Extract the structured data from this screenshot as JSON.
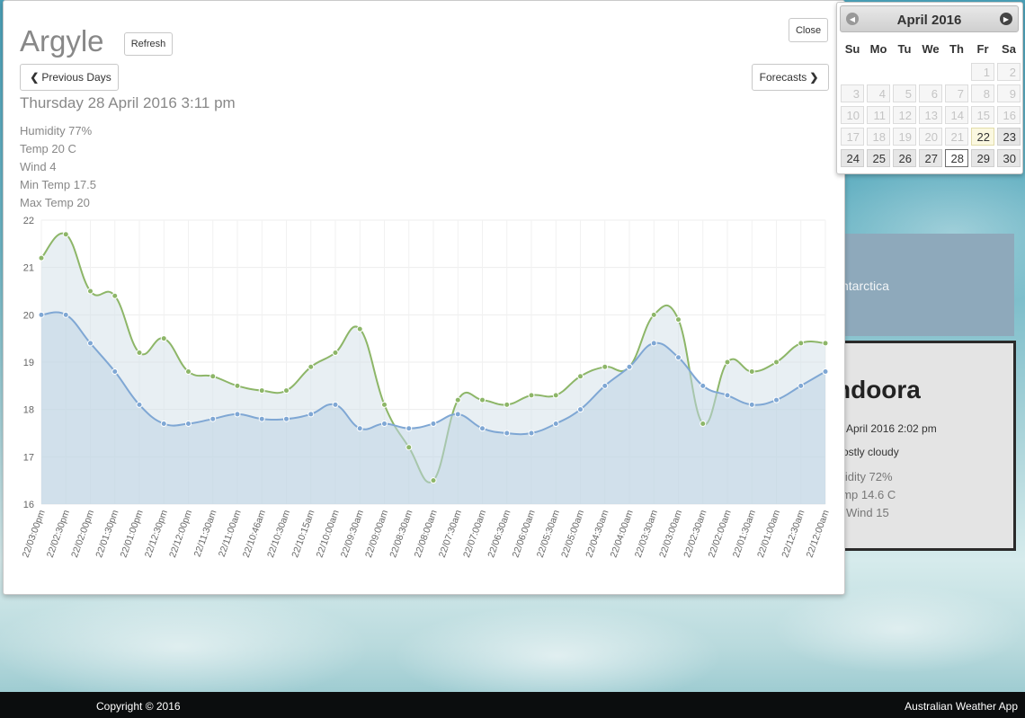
{
  "modal": {
    "title": "Argyle",
    "refresh_label": "Refresh",
    "close_label": "Close",
    "prev_label": "Previous Days",
    "forecasts_label": "Forecasts",
    "datetime": "Thursday 28 April 2016 3:11 pm",
    "stats": [
      "Humidity 77%",
      "Temp 20 C",
      "Wind 4",
      "Min Temp 17.5",
      "Max Temp 20"
    ]
  },
  "chart_data": {
    "type": "line",
    "ylim": [
      16,
      22
    ],
    "yticks": [
      "16",
      "17",
      "18",
      "19",
      "20",
      "21",
      "22"
    ],
    "categories": [
      "22/03:00pm",
      "22/02:30pm",
      "22/02:00pm",
      "22/01:30pm",
      "22/01:00pm",
      "22/12:30pm",
      "22/12:00pm",
      "22/11:30am",
      "22/11:00am",
      "22/10:46am",
      "22/10:30am",
      "22/10:15am",
      "22/10:00am",
      "22/09:30am",
      "22/09:00am",
      "22/08:30am",
      "22/08:00am",
      "22/07:30am",
      "22/07:00am",
      "22/06:30am",
      "22/06:00am",
      "22/05:30am",
      "22/05:00am",
      "22/04:30am",
      "22/04:00am",
      "22/03:30am",
      "22/03:00am",
      "22/02:30am",
      "22/02:00am",
      "22/01:30am",
      "22/01:00am",
      "22/12:30am",
      "22/12:00am"
    ],
    "series": [
      {
        "values": [
          21.2,
          21.7,
          20.5,
          20.4,
          19.2,
          19.5,
          18.8,
          18.7,
          18.5,
          18.4,
          18.4,
          18.9,
          19.2,
          19.7,
          18.1,
          17.2,
          16.5,
          18.2,
          18.2,
          18.1,
          18.3,
          18.3,
          18.7,
          18.9,
          18.9,
          20.0,
          19.9,
          17.7,
          19.0,
          18.8,
          19.0,
          19.4,
          19.4
        ],
        "color": "#8db668"
      },
      {
        "values": [
          20.0,
          20.0,
          19.4,
          18.8,
          18.1,
          17.7,
          17.7,
          17.8,
          17.9,
          17.8,
          17.8,
          17.9,
          18.1,
          17.6,
          17.7,
          17.6,
          17.7,
          17.9,
          17.6,
          17.5,
          17.5,
          17.7,
          18.0,
          18.5,
          18.9,
          19.4,
          19.1,
          18.5,
          18.3,
          18.1,
          18.2,
          18.5,
          18.8
        ],
        "color": "#7fa7d4"
      }
    ]
  },
  "calendar": {
    "title": "April 2016",
    "days_of_week": [
      "Su",
      "Mo",
      "Tu",
      "We",
      "Th",
      "Fr",
      "Sa"
    ],
    "rows": [
      [
        {
          "d": "",
          "s": "empty"
        },
        {
          "d": "",
          "s": "empty"
        },
        {
          "d": "",
          "s": "empty"
        },
        {
          "d": "",
          "s": "empty"
        },
        {
          "d": "",
          "s": "empty"
        },
        {
          "d": "1",
          "s": "off"
        },
        {
          "d": "2",
          "s": "off"
        }
      ],
      [
        {
          "d": "3",
          "s": "off"
        },
        {
          "d": "4",
          "s": "off"
        },
        {
          "d": "5",
          "s": "off"
        },
        {
          "d": "6",
          "s": "off"
        },
        {
          "d": "7",
          "s": "off"
        },
        {
          "d": "8",
          "s": "off"
        },
        {
          "d": "9",
          "s": "off"
        }
      ],
      [
        {
          "d": "10",
          "s": "off"
        },
        {
          "d": "11",
          "s": "off"
        },
        {
          "d": "12",
          "s": "off"
        },
        {
          "d": "13",
          "s": "off"
        },
        {
          "d": "14",
          "s": "off"
        },
        {
          "d": "15",
          "s": "off"
        },
        {
          "d": "16",
          "s": "off"
        }
      ],
      [
        {
          "d": "17",
          "s": "off"
        },
        {
          "d": "18",
          "s": "off"
        },
        {
          "d": "19",
          "s": "off"
        },
        {
          "d": "20",
          "s": "off"
        },
        {
          "d": "21",
          "s": "off"
        },
        {
          "d": "22",
          "s": "hl"
        },
        {
          "d": "23",
          "s": "active"
        }
      ],
      [
        {
          "d": "24",
          "s": "active"
        },
        {
          "d": "25",
          "s": "active"
        },
        {
          "d": "26",
          "s": "active"
        },
        {
          "d": "27",
          "s": "active"
        },
        {
          "d": "28",
          "s": "sel"
        },
        {
          "d": "29",
          "s": "active"
        },
        {
          "d": "30",
          "s": "active"
        }
      ]
    ]
  },
  "cards": {
    "antarctica": "ntarctica",
    "andoora": {
      "title": "ndoora",
      "datetime": "April 2016 2:02 pm",
      "condition": "ostly cloudy",
      "humidity": "midity 72%",
      "temp": "emp 14.6 C",
      "wind": "Wind 15"
    }
  },
  "footer": {
    "copyright": "Copyright © 2016",
    "app_name": "Australian Weather App"
  }
}
